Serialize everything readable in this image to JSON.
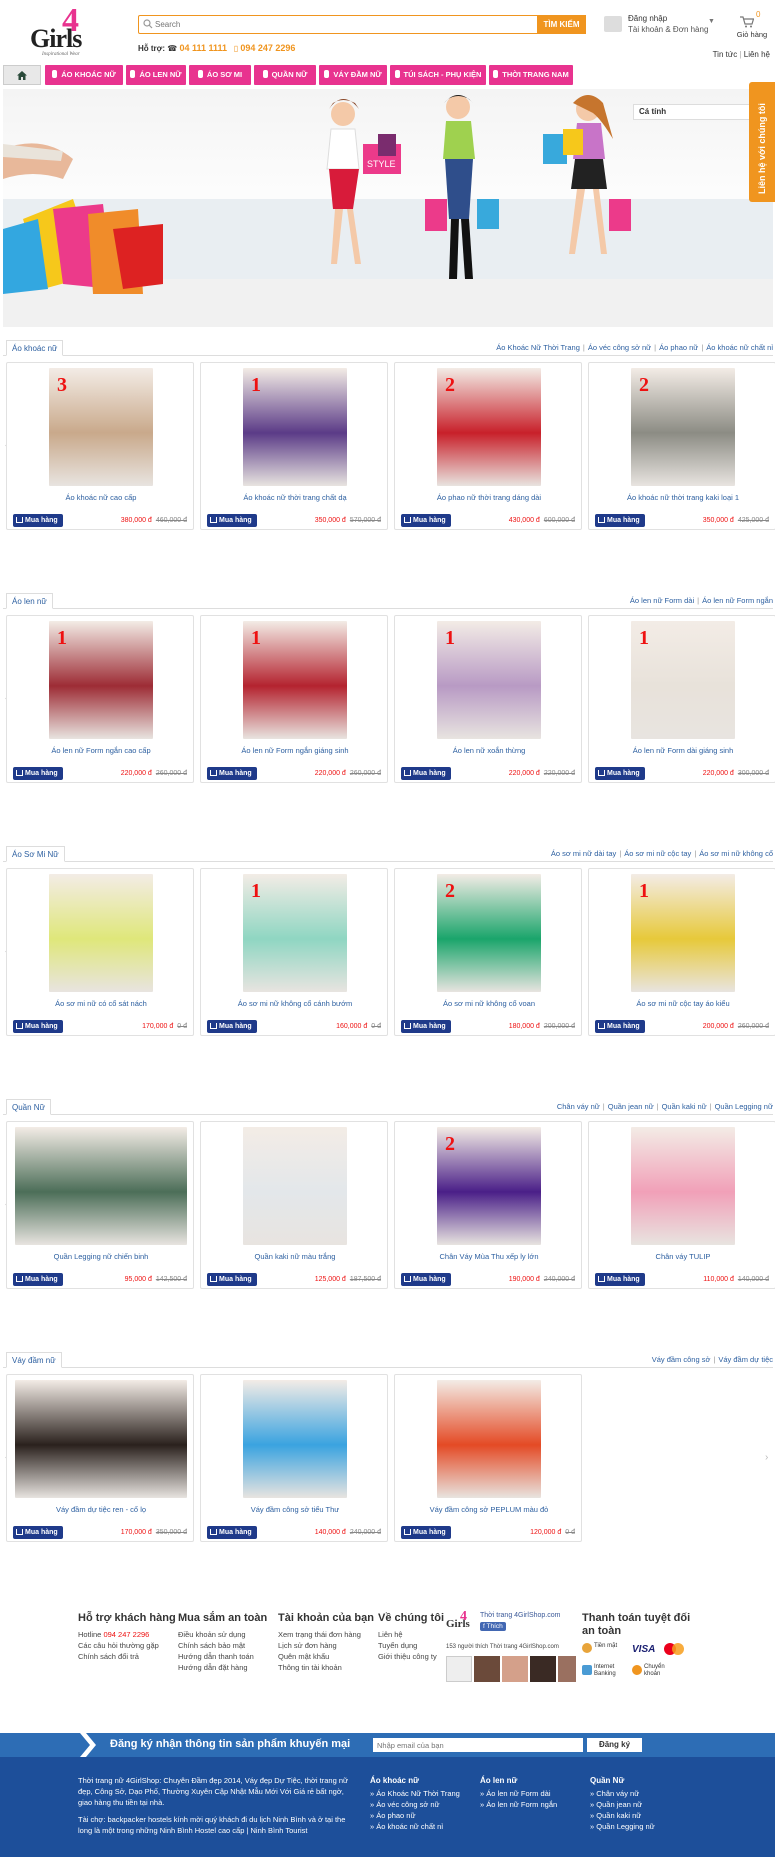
{
  "header": {
    "logo": {
      "letters": "Girls",
      "four": "4",
      "tagline": "Inspirational Wear"
    },
    "search_placeholder": "Search",
    "search_button": "TÌM KIẾM",
    "hotline_label": "Hỗ trợ:",
    "phone1": "04 111 1111",
    "phone2": "094 247 2296",
    "account_line1": "Đăng nhập",
    "account_line2": "Tài khoản & Đơn hàng",
    "cart_count": "0",
    "cart_label": "Giỏ hàng",
    "links": [
      "Tin tức",
      "Liên hệ"
    ]
  },
  "nav": {
    "items": [
      "ÁO KHOÁC NỮ",
      "ÁO LEN NỮ",
      "ÁO SƠ MI",
      "QUẦN NỮ",
      "VÁY ĐẦM NỮ",
      "TÚI SÁCH - PHỤ KIỆN",
      "THỜI TRANG NAM"
    ]
  },
  "banner": {
    "search_text": "Cá tính",
    "brand_tag": "STYLE"
  },
  "side_tab": "Liên hệ với chúng tôi",
  "sections": [
    {
      "title": "Áo khoác nữ",
      "links": [
        "Áo Khoác Nữ Thời Trang",
        "Áo véc công sở nữ",
        "Áo phao nữ",
        "Áo khoác nữ chất nỉ"
      ],
      "products": [
        {
          "rank": "3",
          "name": "Áo khoác nữ cao cấp",
          "price": "380,000 đ",
          "old": "460,000 đ",
          "color": "#c9a98b"
        },
        {
          "rank": "1",
          "name": "Áo khoác nữ thời trang chất dạ",
          "price": "350,000 đ",
          "old": "570,000 đ",
          "color": "#5b3b87"
        },
        {
          "rank": "2",
          "name": "Áo phao nữ thời trang dáng dài",
          "price": "430,000 đ",
          "old": "600,000 đ",
          "color": "#c8202a"
        },
        {
          "rank": "2",
          "name": "Áo khoác nữ thời trang kaki loại 1",
          "price": "350,000 đ",
          "old": "425,000 đ",
          "color": "#8c8c84"
        }
      ]
    },
    {
      "title": "Áo len nữ",
      "links": [
        "Áo len nữ Form dài",
        "Áo len nữ Form ngắn"
      ],
      "products": [
        {
          "rank": "1",
          "name": "Áo len nữ Form ngắn cao cấp",
          "price": "220,000 đ",
          "old": "260,000 đ",
          "color": "#9d2c35"
        },
        {
          "rank": "1",
          "name": "Áo len nữ Form ngắn giáng sinh",
          "price": "220,000 đ",
          "old": "260,000 đ",
          "color": "#b4232f"
        },
        {
          "rank": "1",
          "name": "Áo len nữ xoắn thừng",
          "price": "220,000 đ",
          "old": "220,000 đ",
          "color": "#b89ac4"
        },
        {
          "rank": "1",
          "name": "Áo len nữ Form dài giáng sinh",
          "price": "220,000 đ",
          "old": "300,000 đ",
          "color": "#e8e2da"
        }
      ]
    },
    {
      "title": "Áo Sơ Mi Nữ",
      "links": [
        "Áo sơ mi nữ dài tay",
        "Áo sơ mi nữ cộc tay",
        "Áo sơ mi nữ không cổ"
      ],
      "products": [
        {
          "rank": "",
          "name": "Áo sơ mi nữ có cổ sát nách",
          "price": "170,000 đ",
          "old": "0 đ",
          "color": "#dfe77a"
        },
        {
          "rank": "1",
          "name": "Áo sơ mi nữ không cổ cánh bướm",
          "price": "160,000 đ",
          "old": "0 đ",
          "color": "#8fd6c2"
        },
        {
          "rank": "2",
          "name": "Áo sơ mi nữ không cổ voan",
          "price": "180,000 đ",
          "old": "200,000 đ",
          "color": "#1aa56b"
        },
        {
          "rank": "1",
          "name": "Áo sơ mi nữ cộc tay áo kiểu",
          "price": "200,000 đ",
          "old": "260,000 đ",
          "color": "#e7c93a"
        }
      ]
    },
    {
      "title": "Quần Nữ",
      "links": [
        "Chân váy nữ",
        "Quần jean nữ",
        "Quần kaki nữ",
        "Quần Legging nữ"
      ],
      "products": [
        {
          "rank": "",
          "name": "Quần Legging nữ chiến binh",
          "price": "95,000 đ",
          "old": "142,500 đ",
          "color": "#4c6e58",
          "wide": true
        },
        {
          "rank": "",
          "name": "Quần kaki nữ màu trắng",
          "price": "125,000 đ",
          "old": "187,500 đ",
          "color": "#e3e7ea"
        },
        {
          "rank": "2",
          "name": "Chân Váy Mùa Thu xếp ly lớn",
          "price": "190,000 đ",
          "old": "240,000 đ",
          "color": "#4a1f88"
        },
        {
          "rank": "",
          "name": "Chân váy TULIP",
          "price": "110,000 đ",
          "old": "140,000 đ",
          "color": "#f1a0b8"
        }
      ]
    },
    {
      "title": "Váy đầm nữ",
      "links": [
        "Váy đầm công sở",
        "Váy đầm dự tiệc"
      ],
      "products": [
        {
          "rank": "",
          "name": "Váy đầm dự tiệc ren - cổ lọ",
          "price": "170,000 đ",
          "old": "350,000 đ",
          "color": "#2a211d",
          "wide": true
        },
        {
          "rank": "",
          "name": "Váy đầm công sở tiểu Thư",
          "price": "140,000 đ",
          "old": "240,000 đ",
          "color": "#3aa3e0"
        },
        {
          "rank": "",
          "name": "Váy đầm công sở PEPLUM màu đỏ",
          "price": "120,000 đ",
          "old": "0 đ",
          "color": "#e44a25"
        }
      ]
    }
  ],
  "buy_label": "Mua hàng",
  "footer": {
    "support": {
      "title": "Hỗ trợ khách hàng",
      "hotline_label": "Hotline",
      "hotline": "094 247 2296",
      "lines": [
        "Các câu hỏi thường gặp",
        "Chính sách đổi trả"
      ]
    },
    "safe": {
      "title": "Mua sắm an toàn",
      "lines": [
        "Điều khoản sử dụng",
        "Chính sách bảo mật",
        "Hướng dẫn thanh toán",
        "Hướng dẫn đặt hàng"
      ]
    },
    "account": {
      "title": "Tài khoản của bạn",
      "lines": [
        "Xem trạng thái đơn hàng",
        "Lịch sử đơn hàng",
        "Quên mật khẩu",
        "Thông tin tài khoản"
      ]
    },
    "about": {
      "title": "Về chúng tôi",
      "lines": [
        "Liên hệ",
        "Tuyển dụng",
        "Giới thiệu công ty"
      ]
    },
    "fb": {
      "page": "Thời trang 4GirlShop.com",
      "like": "Thích",
      "count": "153 người thích Thời trang 4GirlShop.com"
    },
    "pay": {
      "title": "Thanh toán tuyệt đối an toàn",
      "items": [
        "Tiền mặt",
        "VISA",
        "Internet Banking",
        "Chuyển khoản"
      ]
    }
  },
  "newsletter": {
    "label": "Đăng ký nhận thông tin sản phẩm khuyến mại",
    "placeholder": "Nhập email của bạn",
    "button": "Đăng ký"
  },
  "bottom": {
    "about1": "Thời trang nữ 4GirlShop: Chuyên Đầm đẹp 2014, Váy đẹp Dự Tiệc, thời trang nữ đẹp, Công Sở, Dạo Phố, Thường Xuyên Cập Nhật Mẫu Mới Với Giá rẻ bất ngờ, giao hàng thu tiền tại nhà.",
    "about2": "Tài chợ: backpacker hostels kính mời quý khách đi du lịch Ninh Bình và ở tại the long là một trong những Ninh Bình Hostel cao cấp | Ninh Bình Tourist",
    "cols": [
      {
        "title": "Áo khoác nữ",
        "items": [
          "Áo Khoác Nữ Thời Trang",
          "Áo véc công sở nữ",
          "Áo phao nữ",
          "Áo khoác nữ chất nỉ"
        ]
      },
      {
        "title": "Áo len nữ",
        "items": [
          "Áo len nữ Form dài",
          "Áo len nữ Form ngắn"
        ]
      },
      {
        "title": "Quần Nữ",
        "items": [
          "Chân váy nữ",
          "Quần jean nữ",
          "Quần kaki nữ",
          "Quần Legging nữ"
        ]
      }
    ]
  }
}
